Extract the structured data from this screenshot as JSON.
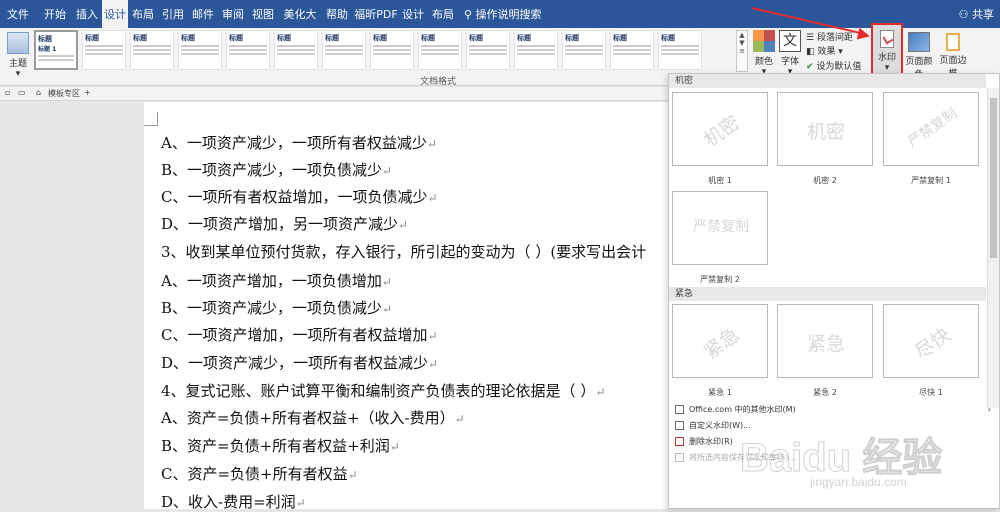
{
  "tabs": [
    "文件",
    "开始",
    "插入",
    "设计",
    "布局",
    "引用",
    "邮件",
    "审阅",
    "视图",
    "美化大师",
    "帮助",
    "福昕PDF",
    "设计",
    "布局"
  ],
  "active_tab_index": 3,
  "tell_me": "操作说明搜索",
  "share_label": "共享",
  "ribbon": {
    "theme_label": "主题",
    "style_title_label": "标题",
    "style_title1_label": "标题 1",
    "gallery_label": "文档格式",
    "colors_label": "颜色",
    "font_label": "字体",
    "font_glyph": "文",
    "paragraph_spacing_label": "段落间距",
    "effects_label": "效果",
    "set_default_label": "设为默认值",
    "watermark_label": "水印",
    "page_color_label": "页面颜色",
    "page_border_label": "页面边框"
  },
  "doc_tab": {
    "label": "模板专区",
    "add": "+"
  },
  "document_lines": [
    "A、一项资产减少，一项所有者权益减少",
    "B、一项资产减少，一项负债减少",
    "C、一项所有者权益增加，一项负债减少",
    "D、一项资产增加，另一项资产减少",
    "3、收到某单位预付货款，存入银行，所引起的变动为（ ）(要求写出会计",
    "A、一项资产增加，一项负债增加",
    "B、一项资产减少，一项负债减少",
    "C、一项资产增加，一项所有者权益增加",
    "D、一项资产减少，一项所有者权益减少",
    "4、复式记账、账户试算平衡和编制资产负债表的理论依据是（ ）",
    "A、资产=负债+所有者权益+（收入-费用）",
    "B、资产=负债+所有者权益+利润",
    "C、资产=负债+所有者权益",
    "D、收入-费用=利润"
  ],
  "paragraph_mark": "↵",
  "watermark_menu": {
    "section_confidential": "机密",
    "section_urgent": "紧急",
    "tiles": [
      {
        "text": "机密",
        "caption": "机密 1",
        "diagonal": true
      },
      {
        "text": "机密",
        "caption": "机密 2",
        "diagonal": false
      },
      {
        "text": "严禁复制",
        "caption": "严禁复制 1",
        "diagonal": true
      },
      {
        "text": "严禁复制",
        "caption": "严禁复制 2",
        "diagonal": false
      },
      {
        "text": "紧急",
        "caption": "紧急 1",
        "diagonal": true
      },
      {
        "text": "紧急",
        "caption": "紧急 2",
        "diagonal": false
      },
      {
        "text": "尽快",
        "caption": "尽快 1",
        "diagonal": true
      }
    ],
    "items": [
      {
        "label": "Office.com 中的其他水印(M)",
        "arrow": "›",
        "disabled": false
      },
      {
        "label": "自定义水印(W)...",
        "arrow": "",
        "disabled": false
      },
      {
        "label": "删除水印(R)",
        "arrow": "",
        "disabled": false
      },
      {
        "label": "将所选内容保存到水印库(S)...",
        "arrow": "",
        "disabled": true
      }
    ]
  },
  "baidu_watermark": {
    "brand": "Baidu 经验",
    "url": "jingyan.baidu.com"
  },
  "colors": {
    "ribbon_blue": "#2b579a",
    "annotation_red": "#e32b2b"
  }
}
